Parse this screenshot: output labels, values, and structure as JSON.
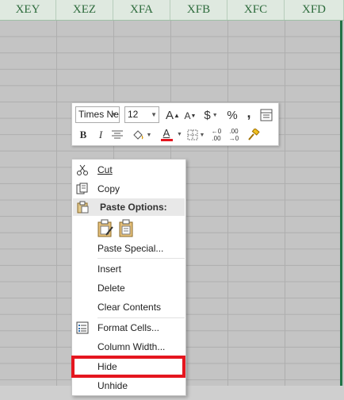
{
  "sheet": {
    "columns": [
      "XEY",
      "XEZ",
      "XFA",
      "XFB",
      "XFC",
      "XFD"
    ]
  },
  "mini_toolbar": {
    "font_name": "Times Ne",
    "font_size": "12",
    "grow_font": "A",
    "shrink_font": "A",
    "currency": "$",
    "percent": "%",
    "comma": ",",
    "bold": "B",
    "italic": "I",
    "font_color_letter": "A",
    "increase_decimal_top": "←0",
    "increase_decimal_bottom": ".00",
    "decrease_decimal_top": ".00",
    "decrease_decimal_bottom": "→0",
    "accent_color": "#e5161f"
  },
  "context_menu": {
    "cut": "Cut",
    "copy": "Copy",
    "paste_options": "Paste Options:",
    "paste_special": "Paste Special...",
    "insert": "Insert",
    "delete": "Delete",
    "clear_contents": "Clear Contents",
    "format_cells": "Format Cells...",
    "column_width": "Column Width...",
    "hide": "Hide",
    "unhide": "Unhide"
  },
  "highlight_color": "#e5161f",
  "icons": [
    "scissors-icon",
    "copy-icon",
    "clipboard-icon",
    "paste-keep-formatting-icon",
    "paste-icon",
    "format-cells-icon",
    "borders-icon",
    "fill-color-icon",
    "format-painter-icon",
    "center-align-icon",
    "number-format-icon"
  ]
}
